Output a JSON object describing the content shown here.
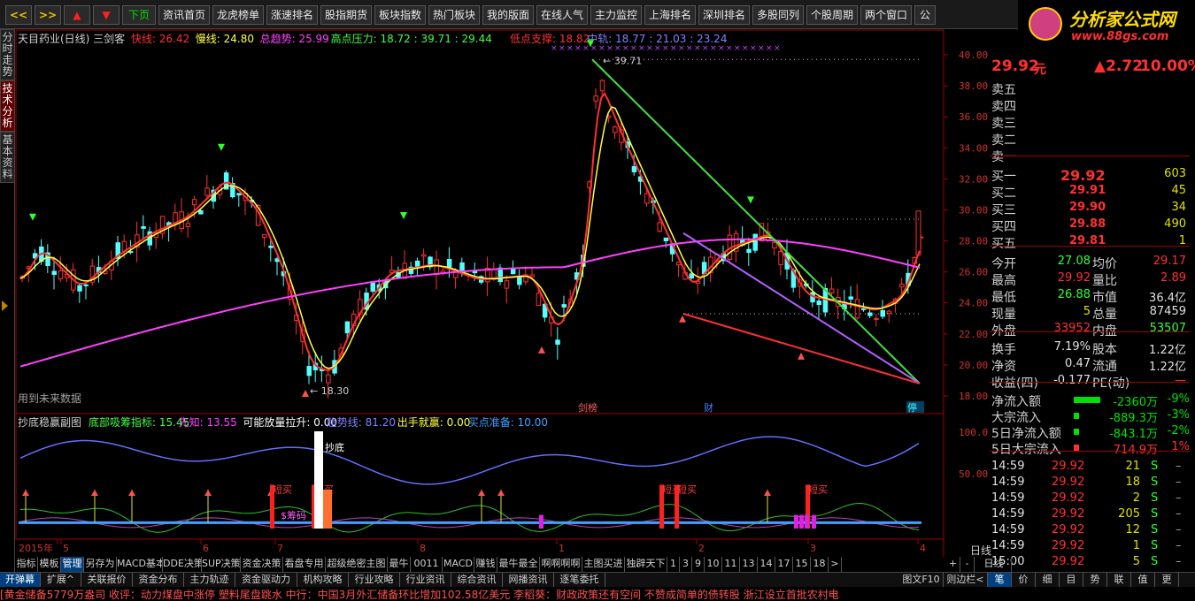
{
  "toolbar": {
    "buttons": [
      "<<",
      ">>",
      "▲",
      "▼",
      "下页",
      "资讯首页",
      "龙虎榜单",
      "涨速排名",
      "股指期货",
      "板块指数",
      "热门板块",
      "我的版面",
      "在线人气",
      "主力监控",
      "上海排名",
      "深圳排名",
      "多股同列",
      "个股周期",
      "两个窗口",
      "公"
    ]
  },
  "logo": {
    "title": "分析家公式网",
    "url": "www.88gs.com"
  },
  "side_tabs": [
    "分时走势",
    "技术分析",
    "基本资料"
  ],
  "main_chart": {
    "title": "天目药业(日线) 三剑客",
    "legend": [
      {
        "label": "快线: 26.42",
        "color": "#ff3030"
      },
      {
        "label": "慢线: 24.80",
        "color": "#ffff40"
      },
      {
        "label": "总趋势: 25.99",
        "color": "#ff40ff"
      },
      {
        "label": "高点压力: 18.72 : 39.71 : 29.44",
        "color": "#40ff40"
      },
      {
        "label": "低点支撑: 18.82",
        "color": "#ff3030"
      },
      {
        "label": "中轨: 18.77 : 21.03 : 23.24",
        "color": "#8080ff"
      }
    ],
    "price_labels": [
      "40.00",
      "38.00",
      "36.00",
      "34.00",
      "32.00",
      "30.00",
      "28.00",
      "26.00",
      "24.00",
      "22.00",
      "20.00",
      "18.00"
    ],
    "high_label": "39.71",
    "low_label": "18.30",
    "future_note": "用到未来数据",
    "markers": [
      "剑榜",
      "财",
      "停"
    ]
  },
  "sub_chart": {
    "title": "抄底稳赢副图",
    "legend": [
      {
        "label": "底部吸筹指标: 15.45",
        "color": "#40ff40"
      },
      {
        "label": "先知: 13.55",
        "color": "#ff40ff"
      },
      {
        "label": "可能放量拉升: 0.00",
        "color": "#ffffff"
      },
      {
        "label": "趋势线: 81.20",
        "color": "#8080ff"
      },
      {
        "label": "出手就赢: 0.00",
        "color": "#ffff40"
      },
      {
        "label": "买点准备: 10.00",
        "color": "#40a0ff"
      }
    ],
    "axis_labels": [
      "100.0",
      "50.00"
    ],
    "texts": [
      "抄底",
      "短买",
      "短买",
      "短买",
      "短买",
      "短买",
      "$筹码"
    ]
  },
  "x_axis": {
    "labels": [
      "2015年",
      "5",
      "6",
      "7",
      "8",
      "1",
      "2",
      "3",
      "4"
    ],
    "period": "日线"
  },
  "stock": {
    "price": "29.92",
    "unit": "元",
    "change": "▲2.72",
    "pct": "10.00%"
  },
  "sell_levels": [
    "卖五",
    "卖四",
    "卖三",
    "卖二",
    "卖一"
  ],
  "buy_levels": [
    {
      "label": "买一",
      "price": "29.92",
      "vol": "603"
    },
    {
      "label": "买二",
      "price": "29.91",
      "vol": "45"
    },
    {
      "label": "买三",
      "price": "29.90",
      "vol": "34"
    },
    {
      "label": "买四",
      "price": "29.88",
      "vol": "490"
    },
    {
      "label": "买五",
      "price": "29.81",
      "vol": "1"
    }
  ],
  "stats": [
    {
      "l1": "今开",
      "v1": "27.08",
      "l2": "均价",
      "v2": "29.17"
    },
    {
      "l1": "最高",
      "v1": "29.92",
      "l2": "量比",
      "v2": "2.89"
    },
    {
      "l1": "最低",
      "v1": "26.88",
      "l2": "市值",
      "v2": "36.4亿"
    },
    {
      "l1": "现量",
      "v1": "5",
      "l2": "总量",
      "v2": "87459"
    },
    {
      "l1": "外盘",
      "v1": "33952",
      "l2": "内盘",
      "v2": "53507"
    }
  ],
  "stats2": [
    {
      "l1": "换手",
      "v1": "7.19%",
      "l2": "股本",
      "v2": "1.22亿"
    },
    {
      "l1": "净资",
      "v1": "0.47",
      "l2": "流通",
      "v2": "1.22亿"
    },
    {
      "l1": "收益(四)",
      "v1": "-0.177",
      "l2": "PE(动)",
      "v2": "—"
    }
  ],
  "flows": [
    {
      "label": "净流入额",
      "value": "-2360万",
      "pct": "-9%",
      "color": "#00e000"
    },
    {
      "label": "大宗流入",
      "value": "-889.3万",
      "pct": "-3%",
      "color": "#00e000"
    },
    {
      "label": "5日净流入额",
      "value": "-843.1万",
      "pct": "-2%",
      "color": "#00e000"
    },
    {
      "label": "5日大宗流入",
      "value": "714.9万",
      "pct": "1%",
      "color": "#ff3030"
    }
  ],
  "ticks": [
    {
      "time": "14:59",
      "price": "29.92",
      "vol": "21",
      "side": "S"
    },
    {
      "time": "14:59",
      "price": "29.92",
      "vol": "18",
      "side": "S"
    },
    {
      "time": "14:59",
      "price": "29.92",
      "vol": "2",
      "side": "S"
    },
    {
      "time": "14:59",
      "price": "29.92",
      "vol": "205",
      "side": "S"
    },
    {
      "time": "14:59",
      "price": "29.92",
      "vol": "12",
      "side": "S"
    },
    {
      "time": "14:59",
      "price": "29.92",
      "vol": "1",
      "side": "S"
    },
    {
      "time": "15:00",
      "price": "29.92",
      "vol": "5",
      "side": "S"
    }
  ],
  "bottom_tabs": [
    "指标",
    "模板",
    "管理",
    "另存为",
    "MACD基本",
    "DDE决策",
    "SUP决策",
    "资金决策",
    "看盘专用",
    "超级绝密主图",
    "最牛",
    "0011",
    "MACD",
    "赚钱",
    "最牛最全",
    "啊啊啊啊",
    "主图买进",
    "独辟天下",
    "1",
    "3",
    "9",
    "10",
    "11",
    "13",
    "14",
    "17",
    "15",
    "18",
    ">"
  ],
  "bottom_tabs_right": [
    "+",
    "-",
    "日线"
  ],
  "status_tabs": [
    "开弹幕",
    "扩展^",
    "关联报价",
    "资金分布",
    "主力轨迹",
    "资金驱动力",
    "机构攻略",
    "行业攻略",
    "行业资讯",
    "综合资讯",
    "网播资讯",
    "逐笔委托"
  ],
  "status_right": [
    "图文F10",
    "则边栏<",
    "笔",
    "价",
    "细",
    "目",
    "势",
    "联",
    "值",
    "更"
  ],
  "ticker": "[黄金储备5779万盎司      收评：动力煤盘中涨停 塑料尾盘跳水      中行：中国3月外汇储备环比增加102.58亿美元      李稻葵：财政政策还有空间 不赞成简单的债转股      浙江设立首批农村电"
}
